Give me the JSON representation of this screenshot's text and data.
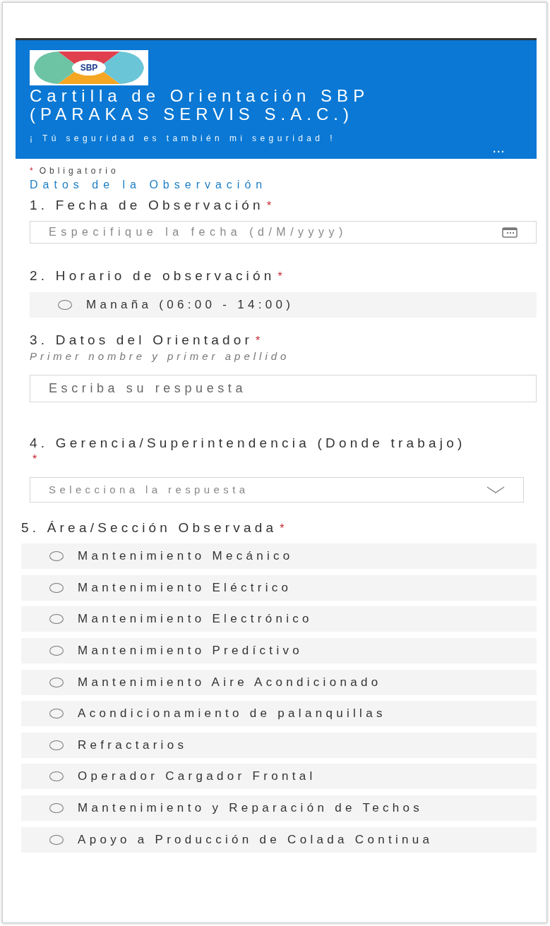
{
  "header": {
    "logo_text": "SBP",
    "title": "Cartilla de Orientación SBP (PARAKAS SERVIS S.A.C.)",
    "subtitle": "¡ Tú seguridad es también mi seguridad !",
    "menu": "..."
  },
  "required_note": {
    "mark": "*",
    "label": "Obligatorio"
  },
  "section_title": "Datos de la Observación",
  "questions": [
    {
      "kind": "date",
      "number": "1.",
      "title": "Fecha de Observación",
      "required": true,
      "placeholder": "Especifique la fecha (d/M/yyyy)"
    },
    {
      "kind": "choice",
      "number": "2.",
      "title": "Horario de observación",
      "required": true,
      "options": [
        {
          "label": "Manaña (06:00 - 14:00)",
          "selected": false
        }
      ]
    },
    {
      "kind": "text",
      "number": "3.",
      "title": "Datos del Orientador",
      "required": true,
      "subtitle": "Primer nombre y primer apellido",
      "placeholder": "Escriba su respuesta"
    },
    {
      "kind": "dropdown",
      "number": "4.",
      "title": "Gerencia/Superintendencia (Donde trabajo)",
      "required": true,
      "placeholder": "Selecciona la respuesta"
    },
    {
      "kind": "choice",
      "number": "5.",
      "title": "Área/Sección Observada",
      "required": true,
      "options": [
        {
          "label": "Mantenimiento Mecánico",
          "selected": false
        },
        {
          "label": "Mantenimiento Eléctrico",
          "selected": false
        },
        {
          "label": "Mantenimiento Electrónico",
          "selected": false
        },
        {
          "label": "Mantenimiento Predíctivo",
          "selected": false
        },
        {
          "label": "Mantenimiento Aire Acondicionado",
          "selected": false
        },
        {
          "label": "Acondicionamiento de palanquillas",
          "selected": false
        },
        {
          "label": "Refractarios",
          "selected": false
        },
        {
          "label": "Operador Cargador Frontal",
          "selected": false
        },
        {
          "label": "Mantenimiento y Reparación de Techos",
          "selected": false
        },
        {
          "label": "Apoyo a Producción de Colada Continua",
          "selected": false
        }
      ]
    }
  ]
}
